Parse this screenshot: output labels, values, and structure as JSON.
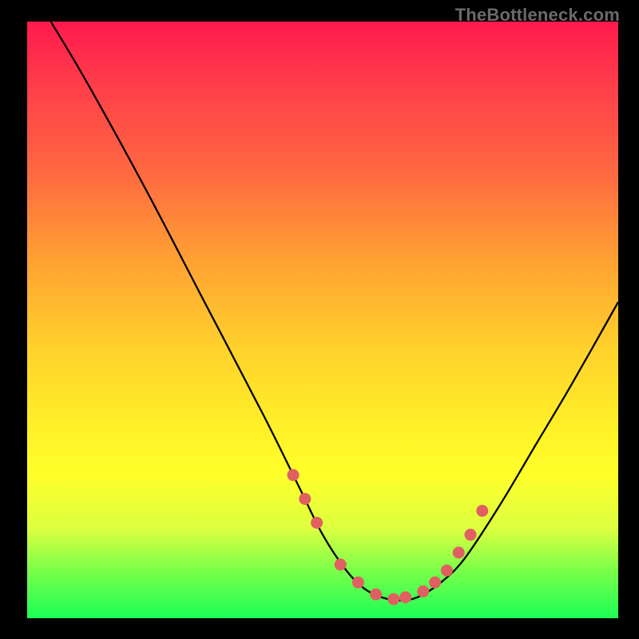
{
  "watermark": "TheBottleneck.com",
  "chart_data": {
    "type": "line",
    "title": "",
    "xlabel": "",
    "ylabel": "",
    "xlim": [
      0,
      100
    ],
    "ylim": [
      0,
      100
    ],
    "series": [
      {
        "name": "curve",
        "x": [
          4,
          10,
          20,
          30,
          40,
          46,
          50,
          54,
          57,
          60,
          63,
          66,
          70,
          74,
          80,
          86,
          92,
          100
        ],
        "y": [
          100,
          90,
          72,
          53,
          34,
          22,
          14,
          8,
          5,
          3.5,
          3,
          3.5,
          6,
          10,
          19,
          29,
          39,
          53
        ]
      }
    ],
    "markers": {
      "name": "highlight-dots",
      "x": [
        45,
        47,
        49,
        53,
        56,
        59,
        62,
        64,
        67,
        69,
        71,
        73,
        75,
        77
      ],
      "y": [
        24,
        20,
        16,
        9,
        6,
        4,
        3.2,
        3.5,
        4.5,
        6,
        8,
        11,
        14,
        18
      ]
    }
  }
}
